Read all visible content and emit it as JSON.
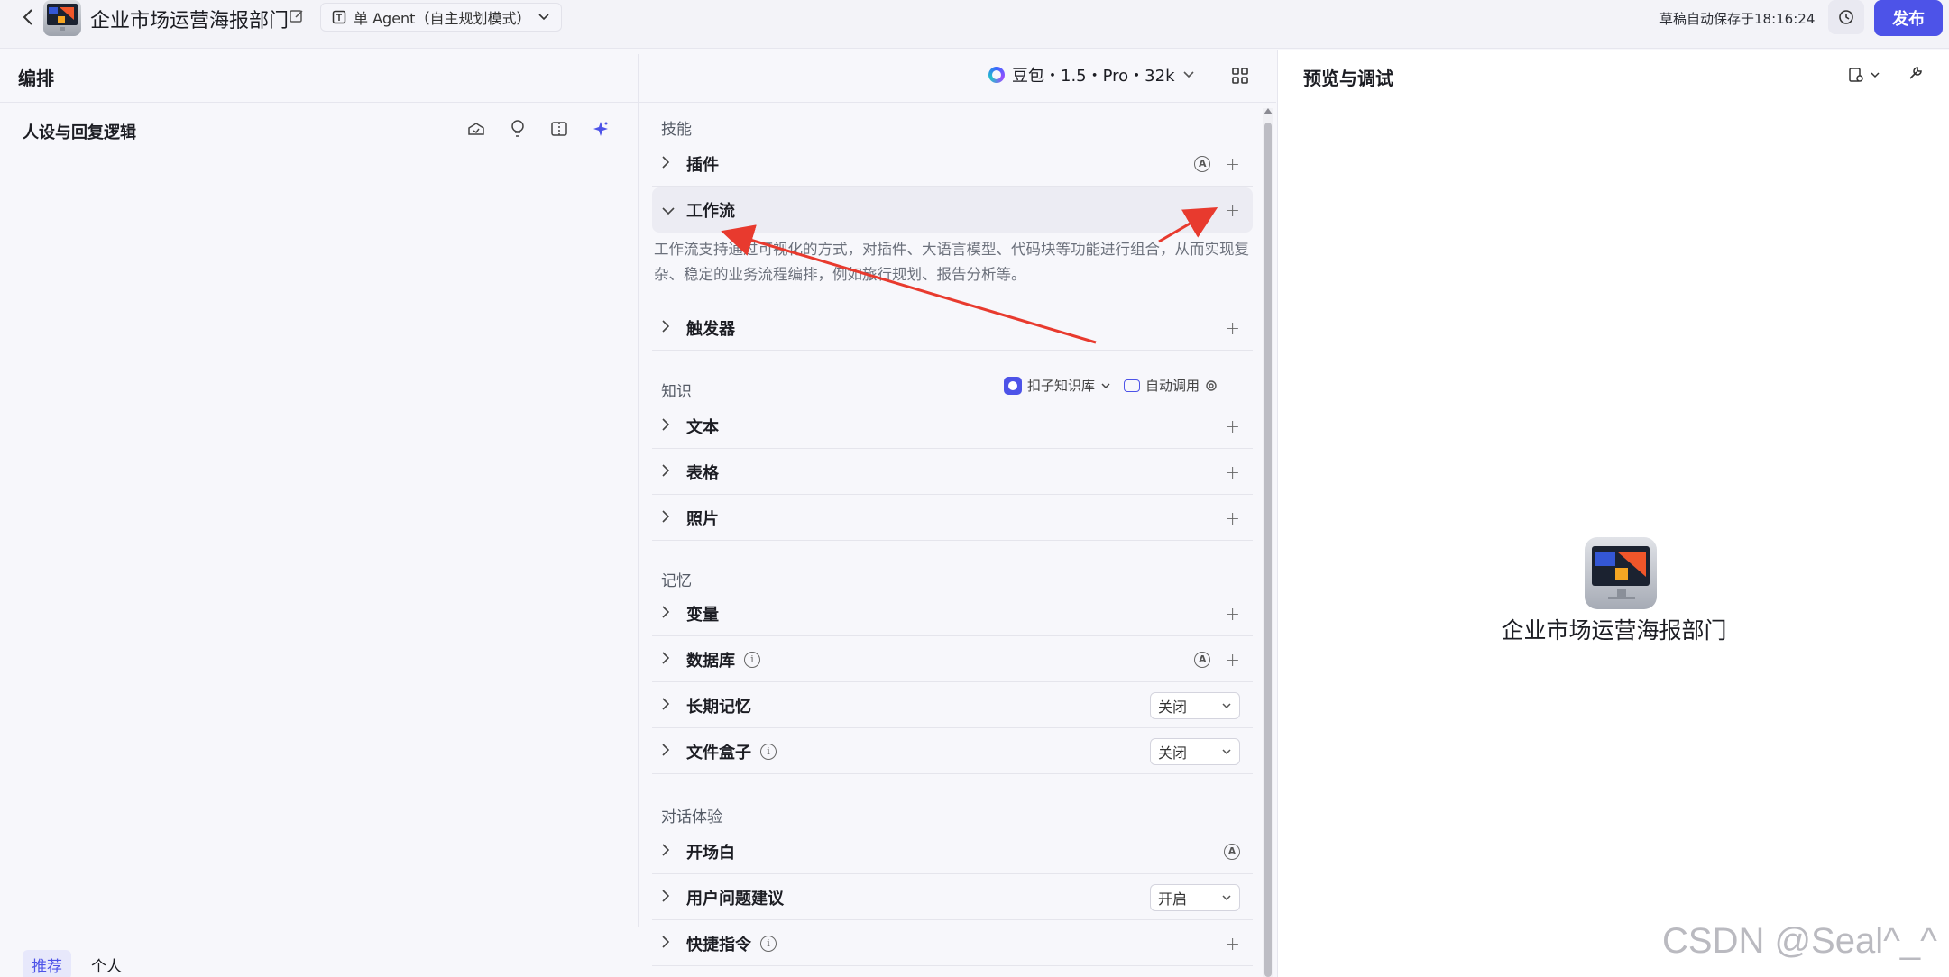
{
  "header": {
    "bot_title": "企业市场运营海报部门",
    "agent_mode": "单 Agent（自主规划模式）",
    "autosave": "草稿自动保存于18:16:24",
    "publish_label": "发布"
  },
  "orchestration": {
    "title": "编排",
    "model": "豆包・1.5・Pro・32k"
  },
  "persona": {
    "title": "人设与回复逻辑",
    "tabs": [
      "推荐",
      "个人"
    ]
  },
  "skills": {
    "section_label": "技能",
    "plugin": "插件",
    "workflow": "工作流",
    "workflow_desc": "工作流支持通过可视化的方式，对插件、大语言模型、代码块等功能进行组合，从而实现复杂、稳定的业务流程编排，例如旅行规划、报告分析等。",
    "trigger": "触发器"
  },
  "knowledge": {
    "section_label": "知识",
    "kb_source": "扣子知识库",
    "auto_call": "自动调用",
    "text": "文本",
    "table": "表格",
    "photo": "照片"
  },
  "memory": {
    "section_label": "记忆",
    "variable": "变量",
    "database": "数据库",
    "long_term": "长期记忆",
    "long_term_value": "关闭",
    "file_box": "文件盒子",
    "file_box_value": "关闭"
  },
  "dialog": {
    "section_label": "对话体验",
    "opening": "开场白",
    "suggestions": "用户问题建议",
    "suggestions_value": "开启",
    "shortcuts": "快捷指令"
  },
  "preview": {
    "title": "预览与调试",
    "bot_name": "企业市场运营海报部门"
  },
  "watermark": "CSDN @Seal^_^",
  "colors": {
    "accent": "#4d53e8",
    "arrow": "#e83a2e"
  }
}
